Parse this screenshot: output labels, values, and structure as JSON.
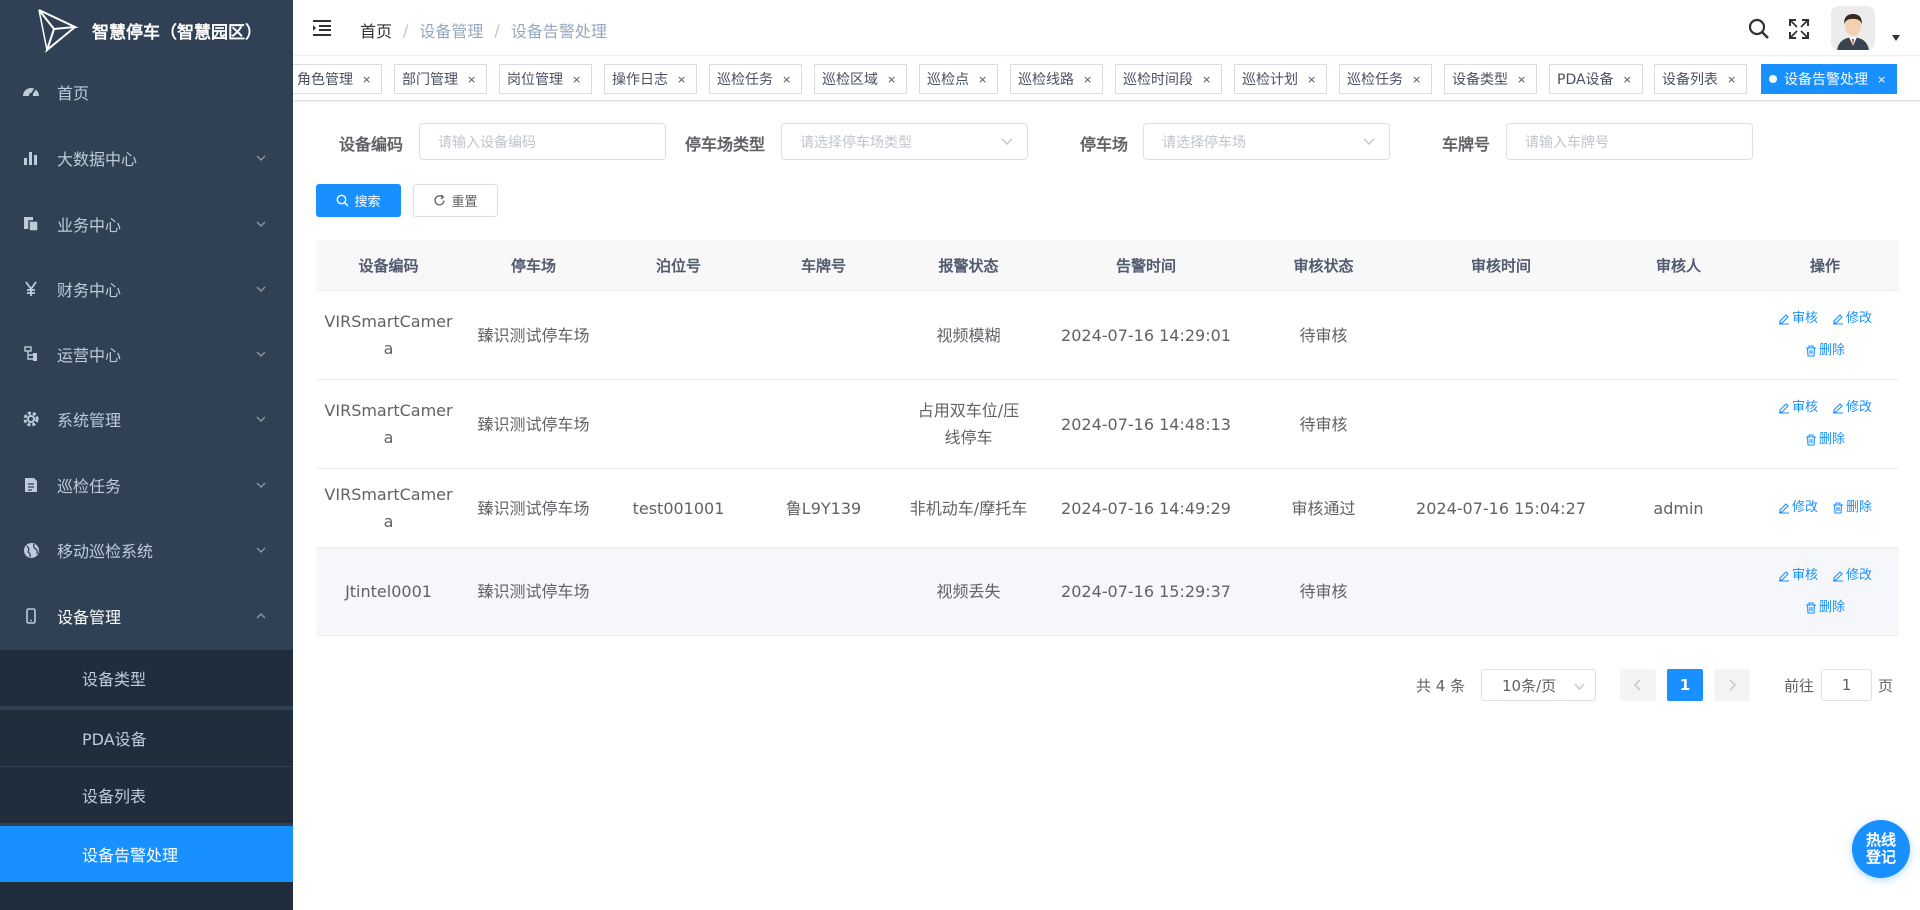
{
  "app": {
    "title": "智慧停车（智慧园区）"
  },
  "sidebar": {
    "items": [
      {
        "label": "首页",
        "icon": "dashboard-icon"
      },
      {
        "label": "大数据中心",
        "icon": "bar-chart-icon"
      },
      {
        "label": "业务中心",
        "icon": "documents-icon"
      },
      {
        "label": "财务中心",
        "icon": "yen-icon"
      },
      {
        "label": "运营中心",
        "icon": "tree-icon"
      },
      {
        "label": "系统管理",
        "icon": "gear-icon"
      },
      {
        "label": "巡检任务",
        "icon": "document-icon"
      },
      {
        "label": "移动巡检系统",
        "icon": "globe-icon"
      },
      {
        "label": "设备管理",
        "icon": "phone-icon"
      }
    ],
    "sub_items": [
      {
        "label": "设备类型"
      },
      {
        "label": "PDA设备"
      },
      {
        "label": "设备列表"
      },
      {
        "label": "设备告警处理"
      }
    ]
  },
  "breadcrumb": {
    "home": "首页",
    "sep": "/",
    "level1": "设备管理",
    "level2": "设备告警处理"
  },
  "tags": [
    {
      "label": "角色管理"
    },
    {
      "label": "部门管理"
    },
    {
      "label": "岗位管理"
    },
    {
      "label": "操作日志"
    },
    {
      "label": "巡检任务"
    },
    {
      "label": "巡检区域"
    },
    {
      "label": "巡检点"
    },
    {
      "label": "巡检线路"
    },
    {
      "label": "巡检时间段"
    },
    {
      "label": "巡检计划"
    },
    {
      "label": "巡检任务"
    },
    {
      "label": "设备类型"
    },
    {
      "label": "PDA设备"
    },
    {
      "label": "设备列表"
    },
    {
      "label": "设备告警处理"
    }
  ],
  "tag_close": "×",
  "search": {
    "device_code": {
      "label": "设备编码",
      "placeholder": "请输入设备编码"
    },
    "lot_type": {
      "label": "停车场类型",
      "placeholder": "请选择停车场类型"
    },
    "lot": {
      "label": "停车场",
      "placeholder": "请选择停车场"
    },
    "plate": {
      "label": "车牌号",
      "placeholder": "请输入车牌号"
    },
    "search_btn": "搜索",
    "reset_btn": "重置"
  },
  "table": {
    "headers": [
      "设备编码",
      "停车场",
      "泊位号",
      "车牌号",
      "报警状态",
      "告警时间",
      "审核状态",
      "审核时间",
      "审核人",
      "操作"
    ],
    "rows": [
      {
        "code": "VIRSmartCamera",
        "lot": "臻识测试停车场",
        "berth": "",
        "plate": "",
        "alarm": "视频模糊",
        "time": "2024-07-16 14:29:01",
        "status": "待审核",
        "audit_time": "",
        "auditor": ""
      },
      {
        "code": "VIRSmartCamera",
        "lot": "臻识测试停车场",
        "berth": "",
        "plate": "",
        "alarm": "占用双车位/压线停车",
        "time": "2024-07-16 14:48:13",
        "status": "待审核",
        "audit_time": "",
        "auditor": ""
      },
      {
        "code": "VIRSmartCamera",
        "lot": "臻识测试停车场",
        "berth": "test001001",
        "plate": "鲁L9Y139",
        "alarm": "非机动车/摩托车",
        "time": "2024-07-16 14:49:29",
        "status": "审核通过",
        "audit_time": "2024-07-16 15:04:27",
        "auditor": "admin"
      },
      {
        "code": "Jtintel0001",
        "lot": "臻识测试停车场",
        "berth": "",
        "plate": "",
        "alarm": "视频丢失",
        "time": "2024-07-16 15:29:37",
        "status": "待审核",
        "audit_time": "",
        "auditor": ""
      }
    ],
    "ops": {
      "audit": "审核",
      "edit": "修改",
      "delete": "删除"
    }
  },
  "pagination": {
    "total": "共 4 条",
    "page_size": "10条/页",
    "current": "1",
    "goto": "前往",
    "goto_value": "1",
    "page_suffix": "页"
  },
  "hotline": {
    "label": "热线登记"
  },
  "colors": {
    "primary": "#1890ff",
    "sidebar_bg": "#304156",
    "submenu_bg": "#1f2d3d"
  }
}
